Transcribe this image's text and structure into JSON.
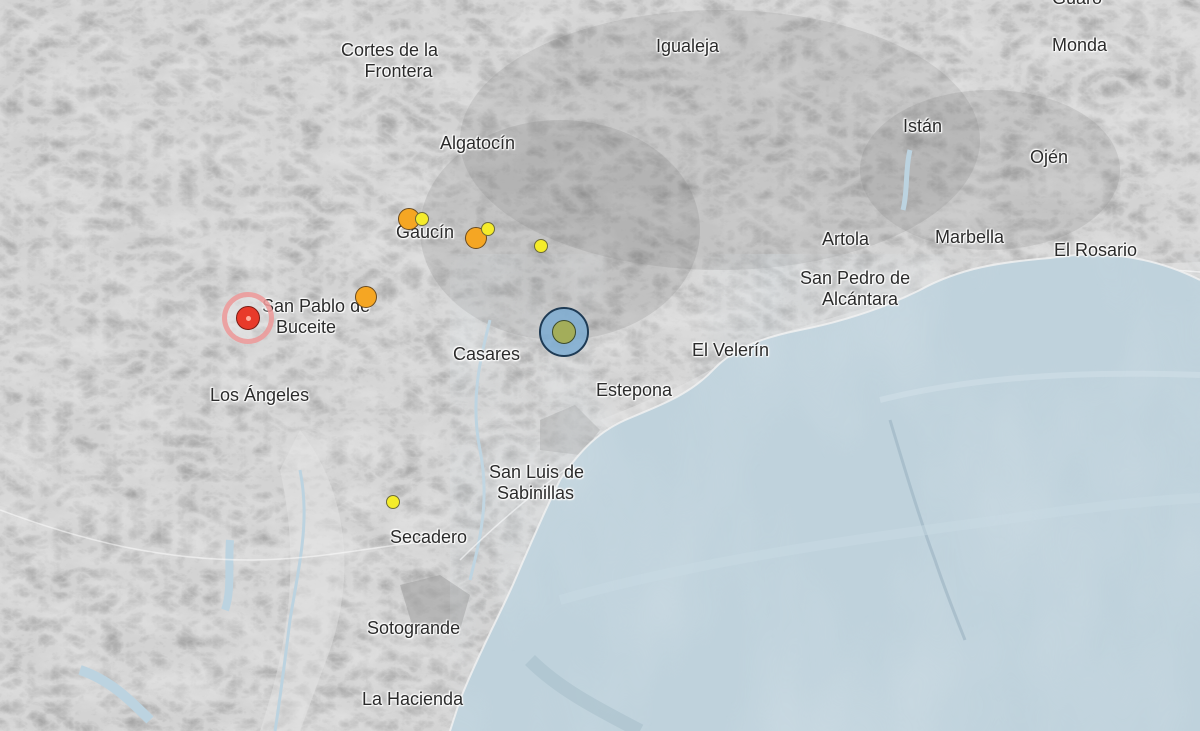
{
  "map": {
    "colors": {
      "land": "#d9d9d9",
      "land_shade": "#a9a9a9",
      "sea": "#bfd2dc",
      "sea_deep": "#b3c9d4",
      "river": "#bcd3e0"
    },
    "places": [
      {
        "id": "cortes",
        "lines": [
          "Cortes de la",
          "Frontera"
        ]
      },
      {
        "id": "igualeja",
        "lines": [
          "Igualeja"
        ]
      },
      {
        "id": "monda",
        "lines": [
          "Monda"
        ]
      },
      {
        "id": "guaro",
        "lines": [
          "Guaro"
        ]
      },
      {
        "id": "algatocin",
        "lines": [
          "Algatocín"
        ]
      },
      {
        "id": "istan",
        "lines": [
          "Istán"
        ]
      },
      {
        "id": "ojen",
        "lines": [
          "Ojén"
        ]
      },
      {
        "id": "gaucin",
        "lines": [
          "Gaucín"
        ]
      },
      {
        "id": "artola",
        "lines": [
          "Artola"
        ]
      },
      {
        "id": "marbella",
        "lines": [
          "Marbella"
        ]
      },
      {
        "id": "el-rosario",
        "lines": [
          "El Rosario"
        ]
      },
      {
        "id": "san-pedro",
        "lines": [
          "San Pedro de",
          "Alcántara"
        ]
      },
      {
        "id": "san-pablo",
        "lines": [
          "San Pablo de",
          "Buceite"
        ]
      },
      {
        "id": "casares",
        "lines": [
          "Casares"
        ]
      },
      {
        "id": "el-velerin",
        "lines": [
          "El Velerín"
        ]
      },
      {
        "id": "estepona",
        "lines": [
          "Estepona"
        ]
      },
      {
        "id": "los-angeles",
        "lines": [
          "Los Ángeles"
        ]
      },
      {
        "id": "san-luis",
        "lines": [
          "San Luis de",
          "Sabinillas"
        ]
      },
      {
        "id": "secadero",
        "lines": [
          "Secadero"
        ]
      },
      {
        "id": "sotogrande",
        "lines": [
          "Sotogrande"
        ]
      },
      {
        "id": "la-hacienda",
        "lines": [
          "La Hacienda"
        ]
      }
    ],
    "earthquakes": [
      {
        "id": "eq-1",
        "category": "orange"
      },
      {
        "id": "eq-2",
        "category": "yellow"
      },
      {
        "id": "eq-3",
        "category": "orange"
      },
      {
        "id": "eq-4",
        "category": "yellow"
      },
      {
        "id": "eq-5",
        "category": "yellow"
      },
      {
        "id": "eq-6",
        "category": "orange"
      },
      {
        "id": "eq-7",
        "category": "red-halo"
      },
      {
        "id": "eq-8",
        "category": "blue-halo"
      },
      {
        "id": "eq-9",
        "category": "yellow"
      }
    ]
  }
}
